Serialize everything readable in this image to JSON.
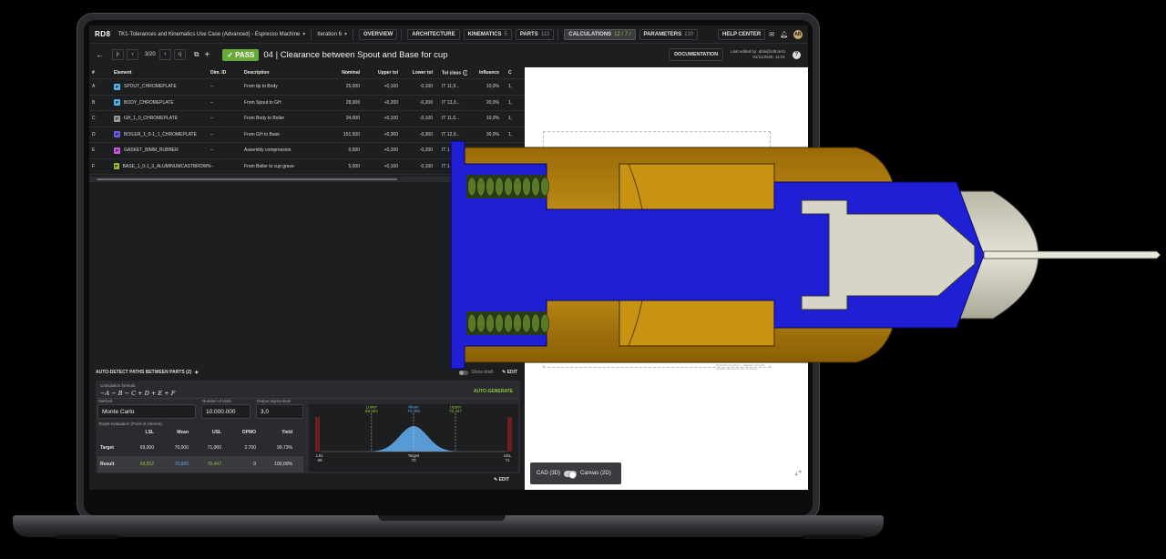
{
  "app": {
    "logo": "RD8",
    "project": "TK1-Tolerances and Kinematics Use Case (Advanced) - Espresso Machine",
    "iteration": "Iteration 6"
  },
  "nav": [
    {
      "label": "OVERVIEW",
      "count": ""
    },
    {
      "label": "ARCHITECTURE",
      "count": ""
    },
    {
      "label": "KINEMATICS",
      "count": "5"
    },
    {
      "label": "PARTS",
      "count": "113"
    },
    {
      "label": "CALCULATIONS",
      "count": "12 / 7 /"
    },
    {
      "label": "PARAMETERS",
      "count": "130"
    }
  ],
  "help": "HELP CENTER",
  "avatar": "AB",
  "toolbar": {
    "pager": "3/20",
    "status": "✓ PASS",
    "title": "04 | Clearance between Spout and Base for cup",
    "doc": "DOCUMENTATION",
    "edited_by": "Last edited by: abla@rd8.tech",
    "edited_at": "04/11/2025, 11:01"
  },
  "table": {
    "headers": [
      "#",
      "Element",
      "Dim. ID",
      "Description",
      "Nominal",
      "Upper tol",
      "Lower tol",
      "Tol class",
      "Influence",
      "C"
    ],
    "rows": [
      {
        "id": "A",
        "tag": "P",
        "tagColor": "#4fb3e8",
        "element": "SPOUT_CHROMEPLATE",
        "dim": "–",
        "desc": "From tip to Body",
        "nominal": "25,000",
        "upper": "+0,100",
        "lower": "-0,100",
        "tolclass": "IT 11,9...",
        "influence": "10,0%",
        "c": "1,"
      },
      {
        "id": "B",
        "tag": "P",
        "tagColor": "#4fb3e8",
        "element": "BODY_CHROMEPLATE",
        "dim": "–",
        "desc": "From Spout to GH",
        "nominal": "28,000",
        "upper": "+0,200",
        "lower": "-0,200",
        "tolclass": "IT 13,3...",
        "influence": "20,0%",
        "c": "1,"
      },
      {
        "id": "C",
        "tag": "P",
        "tagColor": "#9a9a9a",
        "element": "GH_1_0_CHROMEPLATE",
        "dim": "–",
        "desc": "From Body to Boiler",
        "nominal": "34,000",
        "upper": "+0,100",
        "lower": "-0,100",
        "tolclass": "IT 11,6...",
        "influence": "10,0%",
        "c": "1,"
      },
      {
        "id": "D",
        "tag": "P",
        "tagColor": "#6a5be0",
        "element": "BOILER_1_0-1_1_CHROMEPLATE",
        "dim": "–",
        "desc": "From GH to Base",
        "nominal": "151,500",
        "upper": "+0,300",
        "lower": "-0,300",
        "tolclass": "IT 12,9...",
        "influence": "30,0%",
        "c": "1,"
      },
      {
        "id": "E",
        "tag": "P",
        "tagColor": "#c45bd6",
        "element": "GASKET_BIMM_RUBBER",
        "dim": "–",
        "desc": "Assembly compression",
        "nominal": "0,500",
        "upper": "+0,200",
        "lower": "-0,200",
        "tolclass": "IT 1",
        "influence": "",
        "c": ""
      },
      {
        "id": "F",
        "tag": "P",
        "tagColor": "#9ab83a",
        "element": "BASE_1_0-1_3_ALUMINUMCASTBROWN",
        "dim": "–",
        "desc": "From Boiler to cup grave",
        "nominal": "5,000",
        "upper": "+0,100",
        "lower": "-0,100",
        "tolclass": "IT 1",
        "influence": "",
        "c": ""
      }
    ]
  },
  "calc": {
    "autodetect": "AUTO-DETECT PATHS BETWEEN PARTS (2)",
    "draft": "Show draft",
    "edit": "EDIT",
    "formula_label": "Calculation formula",
    "formula": "−A − B − C + D + E + F",
    "autogen": "AUTO-GENERATE",
    "method_label": "Method",
    "method": "Monte Carlo",
    "trials_label": "Number of trials",
    "trials": "10.000.000",
    "sigma_label": "Output sigma level",
    "sigma": "3,0",
    "te_label": "Target evaluation (Point of interest)",
    "te_headers": [
      "",
      "LSL",
      "Mean",
      "USL",
      "DPMO",
      "Yield"
    ],
    "target": {
      "label": "Target",
      "lsl": "69,000",
      "mean": "70,000",
      "usl": "71,000",
      "dpmo": "2.700",
      "yield": "99,73%"
    },
    "result": {
      "label": "Result",
      "lsl": "69,552",
      "mean": "70,000",
      "usl": "70,447",
      "dpmo": "0",
      "yield": "100,00%"
    }
  },
  "chart_data": {
    "type": "area",
    "title": "",
    "x_range": [
      69,
      71
    ],
    "markers": [
      {
        "label": "Lower",
        "value": "69,552",
        "x": 69.552
      },
      {
        "label": "Mean",
        "value": "70,000",
        "x": 70.0
      },
      {
        "label": "Upper",
        "value": "70,447",
        "x": 70.447
      }
    ],
    "axis": [
      {
        "label": "LSL",
        "value": "69",
        "x": 69
      },
      {
        "label": "Target",
        "value": "70",
        "x": 70
      },
      {
        "label": "USL",
        "value": "71",
        "x": 71
      }
    ],
    "distribution": {
      "mean": 70.0,
      "sigma": 0.149
    },
    "colors": {
      "fill": "#5fa8e8",
      "lower": "#8cc63f",
      "mean": "#5fa8e8",
      "limit": "#c0392b"
    }
  },
  "canvas": {
    "cad": "CAD (3D)",
    "canvas": "Canvas (2D)",
    "note": "Illustration purposes – diagram currently contains info not be part of project"
  }
}
